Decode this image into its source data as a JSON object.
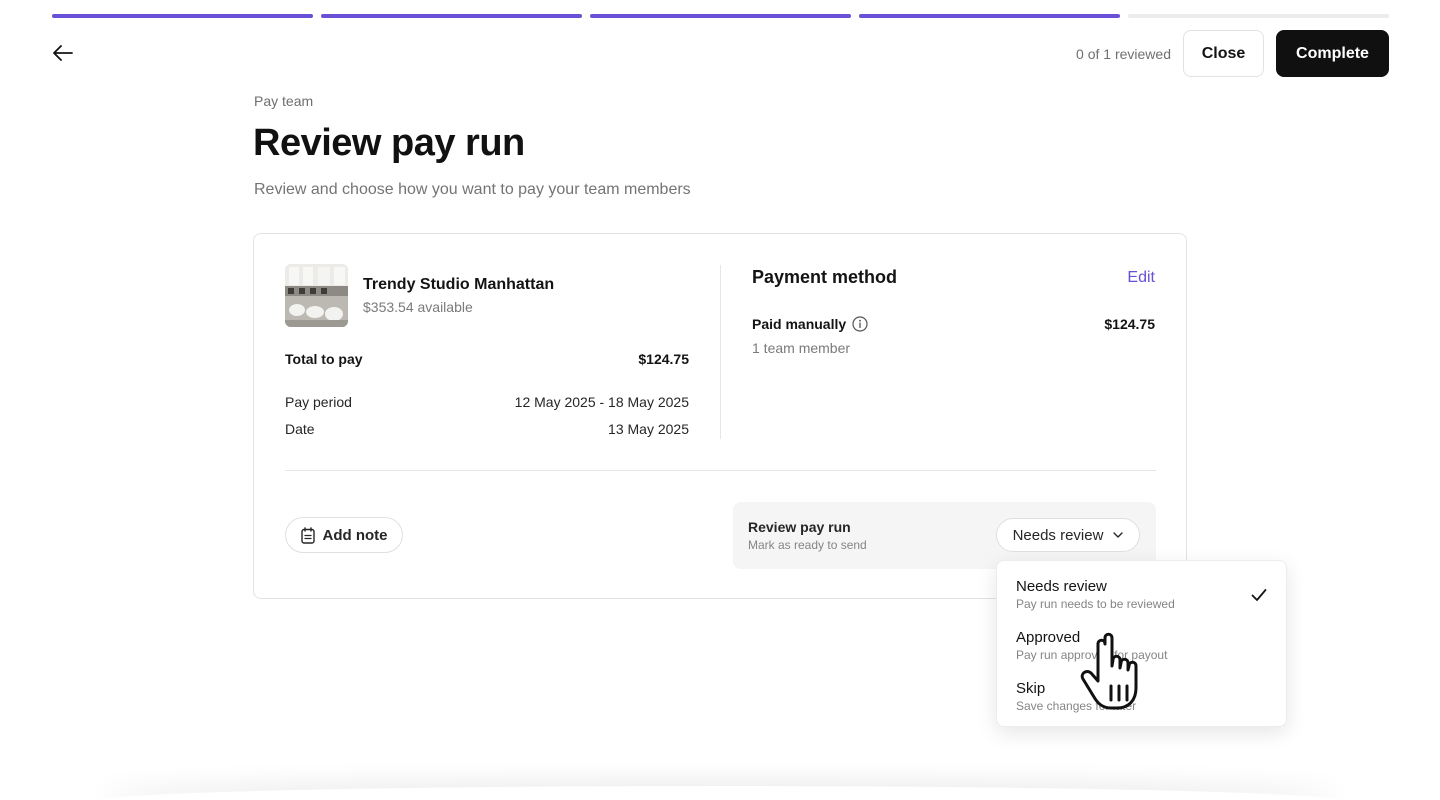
{
  "progress": {
    "total_steps": 5,
    "completed_steps": 4,
    "accent": "#6950d6"
  },
  "header": {
    "back_icon": "arrow-left-icon",
    "reviewed_status": "0 of 1 reviewed",
    "close_label": "Close",
    "complete_label": "Complete"
  },
  "page": {
    "breadcrumb": "Pay team",
    "title": "Review pay run",
    "subtitle": "Review and choose how you want to pay your team members"
  },
  "location": {
    "name": "Trendy Studio Manhattan",
    "available": "$353.54 available"
  },
  "summary": {
    "total_label": "Total to pay",
    "total_value": "$124.75",
    "period_label": "Pay period",
    "period_value": "12 May 2025 - 18 May 2025",
    "date_label": "Date",
    "date_value": "13 May 2025"
  },
  "payment_method": {
    "title": "Payment method",
    "edit_label": "Edit",
    "method_label": "Paid manually",
    "method_amount": "$124.75",
    "members": "1 team member"
  },
  "note": {
    "label": "Add note",
    "icon": "note-icon"
  },
  "review": {
    "title": "Review pay run",
    "subtitle": "Mark as ready to send",
    "selected": "Needs review"
  },
  "dropdown": {
    "options": [
      {
        "label": "Needs review",
        "sub": "Pay run needs to be reviewed",
        "selected": true
      },
      {
        "label": "Approved",
        "sub": "Pay run approved for payout",
        "selected": false
      },
      {
        "label": "Skip",
        "sub": "Save changes for later",
        "selected": false
      }
    ]
  }
}
